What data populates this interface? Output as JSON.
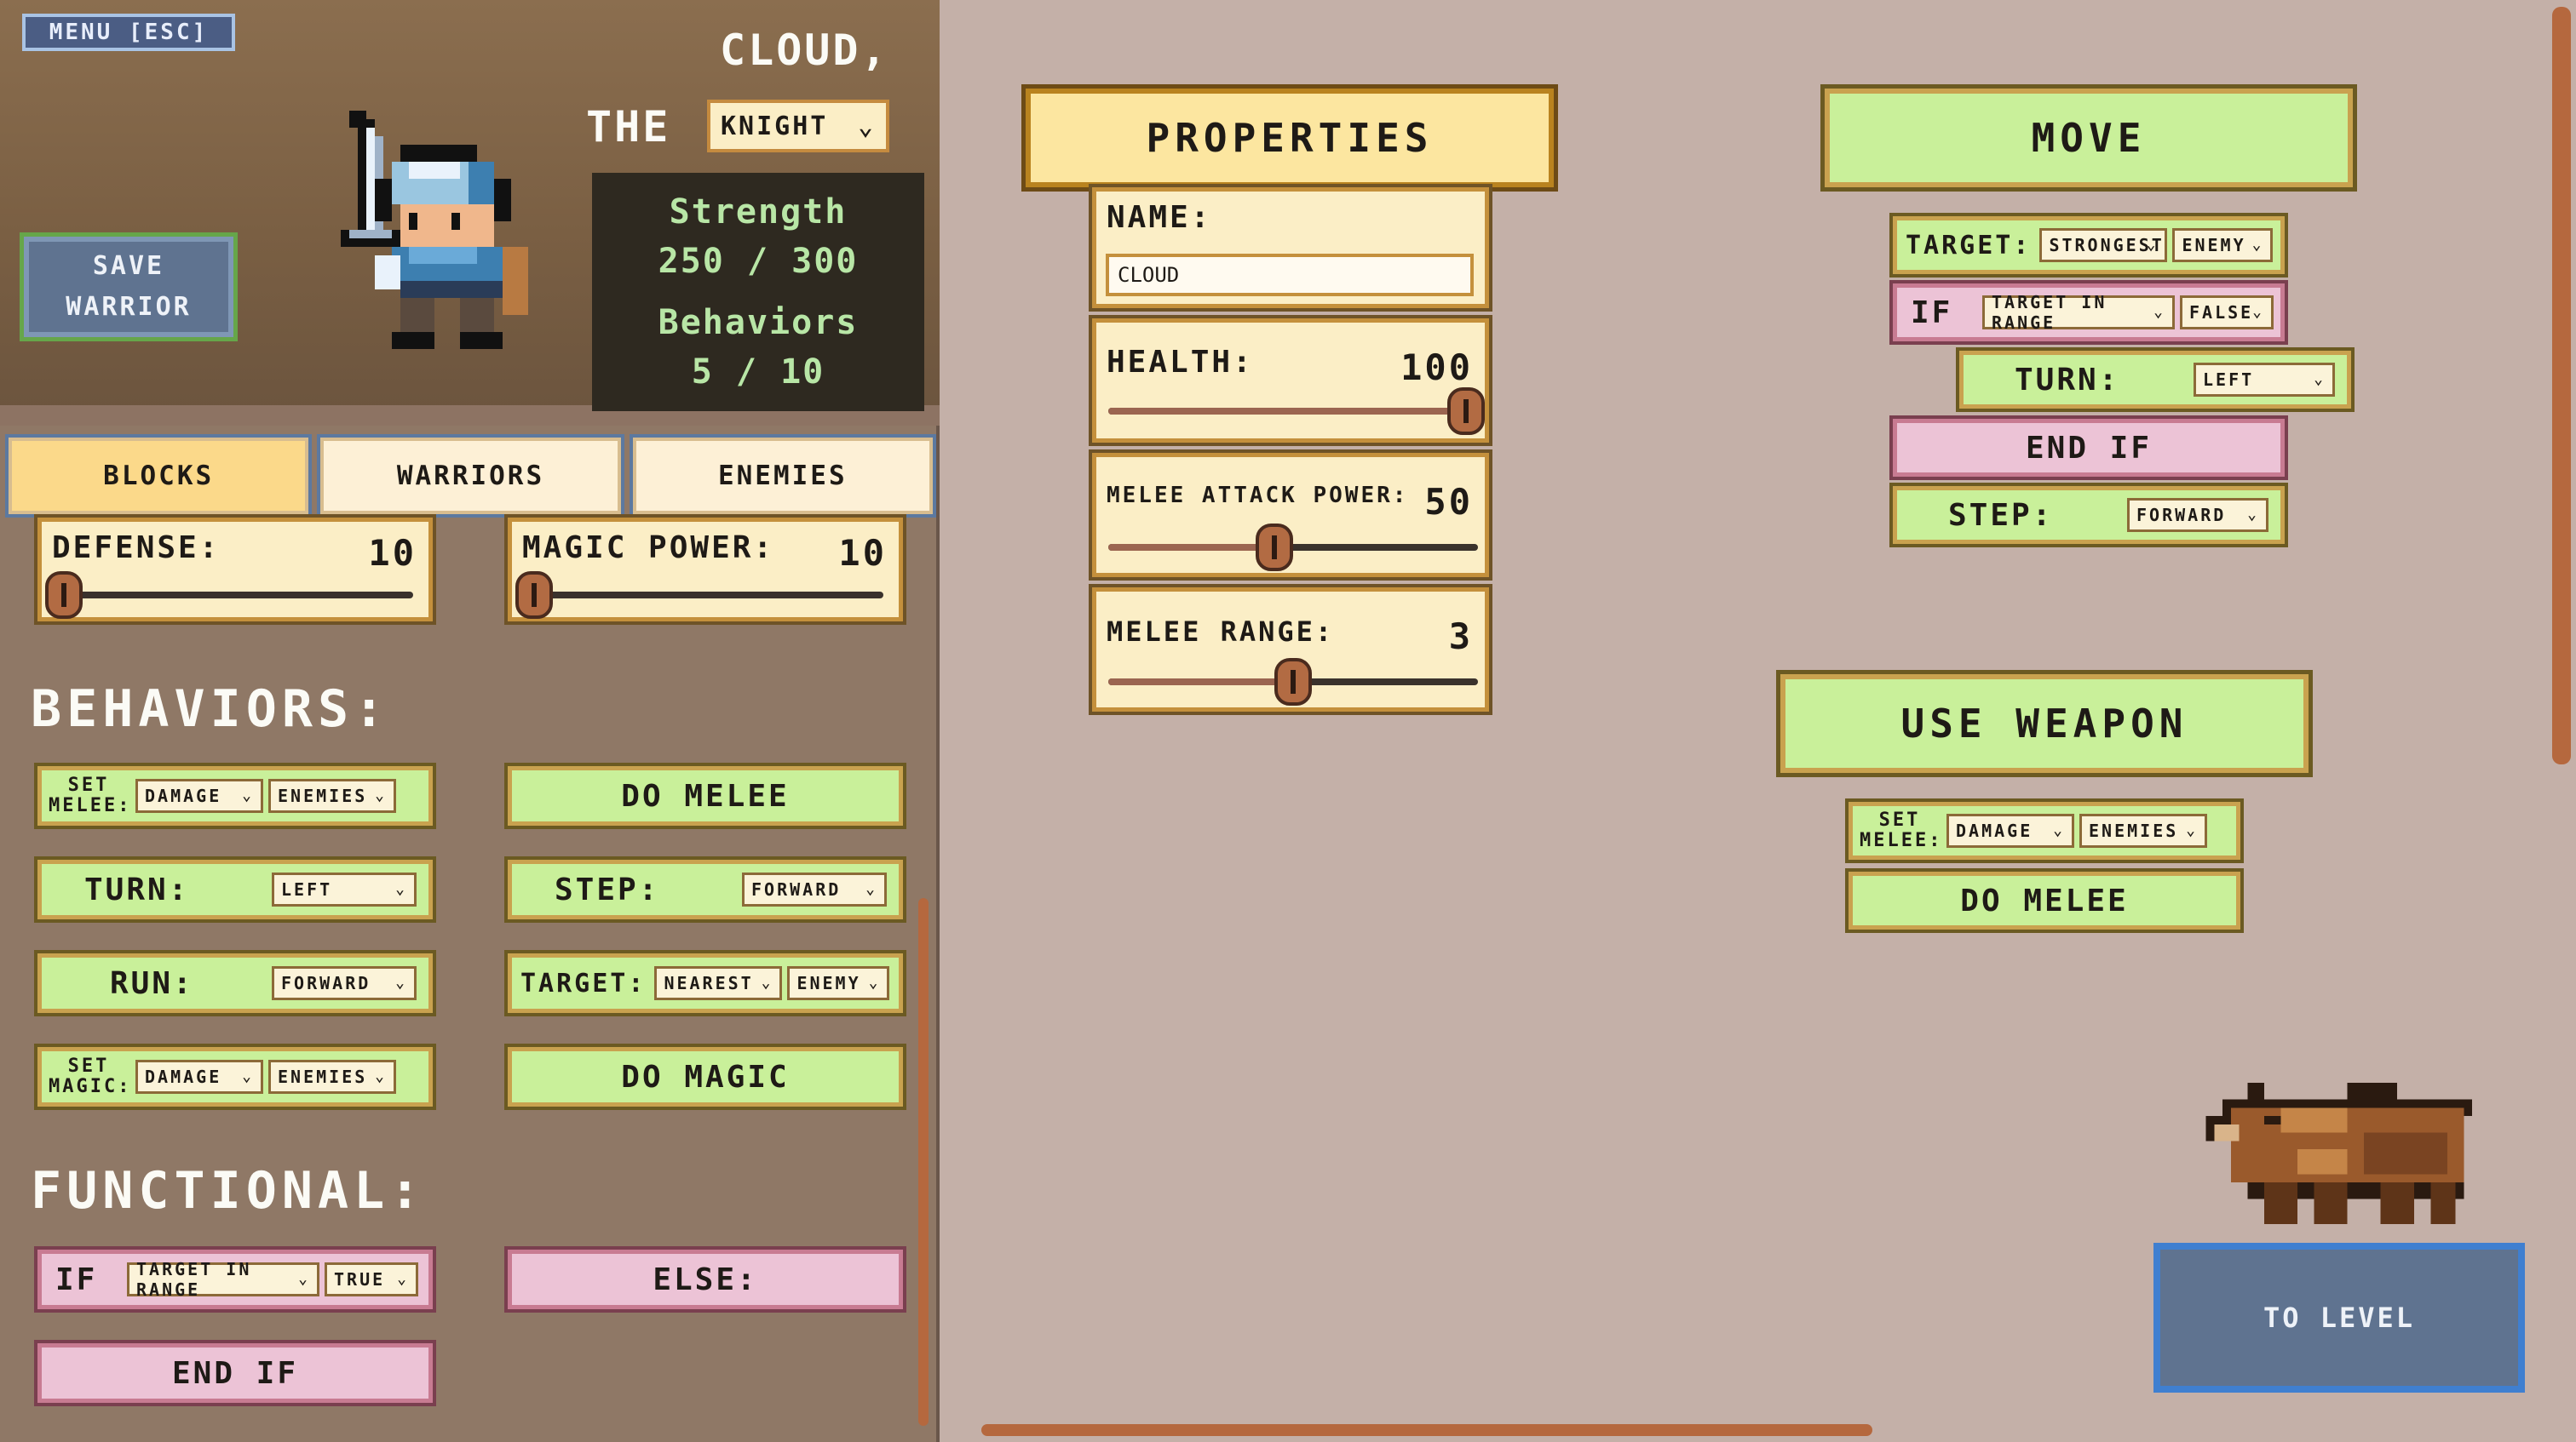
{
  "header": {
    "menu_label": "MENU [ESC]",
    "save_label_1": "SAVE",
    "save_label_2": "WARRIOR",
    "warrior_name": "CLOUD,",
    "the_label": "THE",
    "class_value": "KNIGHT",
    "strength_title": "Strength",
    "strength_value": "250 / 300",
    "behaviors_title": "Behaviors",
    "behaviors_value": "5 / 10"
  },
  "tabs": [
    {
      "label": "BLOCKS",
      "active": true
    },
    {
      "label": "WARRIORS",
      "active": false
    },
    {
      "label": "ENEMIES",
      "active": false
    }
  ],
  "left_sliders": [
    {
      "label": "DEFENSE:",
      "value": "10",
      "fill_fraction": 0.0
    },
    {
      "label": "MAGIC POWER:",
      "value": "10",
      "fill_fraction": 0.0
    }
  ],
  "sections": {
    "behaviors": "BEHAVIORS:",
    "functional": "FUNCTIONAL:"
  },
  "palette": {
    "set_melee": {
      "label": "SET MELEE:",
      "dd1": "DAMAGE",
      "dd2": "ENEMIES"
    },
    "do_melee": "DO MELEE",
    "turn": {
      "label": "TURN:",
      "dd": "LEFT"
    },
    "step": {
      "label": "STEP:",
      "dd": "FORWARD"
    },
    "run": {
      "label": "RUN:",
      "dd": "FORWARD"
    },
    "target": {
      "label": "TARGET:",
      "dd1": "NEAREST",
      "dd2": "ENEMY"
    },
    "set_magic": {
      "label": "SET MAGIC:",
      "dd1": "DAMAGE",
      "dd2": "ENEMIES"
    },
    "do_magic": "DO MAGIC",
    "if": {
      "label": "IF",
      "dd1": "TARGET IN RANGE",
      "dd2": "TRUE"
    },
    "else": "ELSE:",
    "end_if": "END IF"
  },
  "properties": {
    "title": "PROPERTIES",
    "name_label": "NAME:",
    "name_value": "CLOUD",
    "sliders": [
      {
        "label": "HEALTH:",
        "value": "100",
        "fill_fraction": 1.0
      },
      {
        "label": "MELEE ATTACK POWER:",
        "value": "50",
        "fill_fraction": 0.45
      },
      {
        "label": "MELEE RANGE:",
        "value": "3",
        "fill_fraction": 0.5
      }
    ]
  },
  "move": {
    "title": "MOVE",
    "target": {
      "label": "TARGET:",
      "dd1": "STRONGEST",
      "dd2": "ENEMY"
    },
    "if": {
      "label": "IF",
      "dd1": "TARGET IN RANGE",
      "dd2": "FALSE"
    },
    "turn": {
      "label": "TURN:",
      "dd": "LEFT"
    },
    "end_if": "END IF",
    "step": {
      "label": "STEP:",
      "dd": "FORWARD"
    }
  },
  "use_weapon": {
    "title": "USE WEAPON",
    "set_melee": {
      "label": "SET MELEE:",
      "dd1": "DAMAGE",
      "dd2": "ENEMIES"
    },
    "do_melee": "DO MELEE"
  },
  "to_level_label": "TO LEVEL",
  "icons": [
    "knight-sprite",
    "bear-sprite",
    "chevron-down-icon"
  ]
}
